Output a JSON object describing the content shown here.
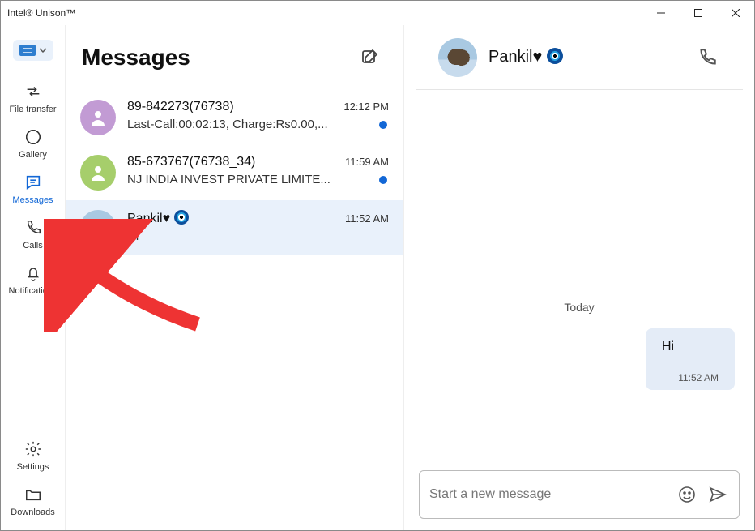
{
  "window": {
    "title": "Intel® Unison™"
  },
  "sidebar": {
    "items": [
      {
        "label": "File transfer"
      },
      {
        "label": "Gallery"
      },
      {
        "label": "Messages"
      },
      {
        "label": "Calls"
      },
      {
        "label": "Notifications"
      }
    ],
    "footer": [
      {
        "label": "Settings"
      },
      {
        "label": "Downloads"
      }
    ]
  },
  "messages": {
    "header": "Messages",
    "conversations": [
      {
        "name": "89-842273(76738)",
        "time": "12:12 PM",
        "preview": "Last-Call:00:02:13, Charge:Rs0.00,...",
        "unread": true
      },
      {
        "name": "85-673767(76738_34)",
        "time": "11:59 AM",
        "preview": "NJ INDIA INVEST PRIVATE LIMITE...",
        "unread": true
      },
      {
        "name": "Pankil♥",
        "time": "11:52 AM",
        "preview": "Hi",
        "unread": false
      }
    ]
  },
  "chat": {
    "contact_name": "Pankil♥",
    "day_label": "Today",
    "message": {
      "text": "Hi",
      "time": "11:52 AM"
    },
    "composer_placeholder": "Start a new message"
  }
}
